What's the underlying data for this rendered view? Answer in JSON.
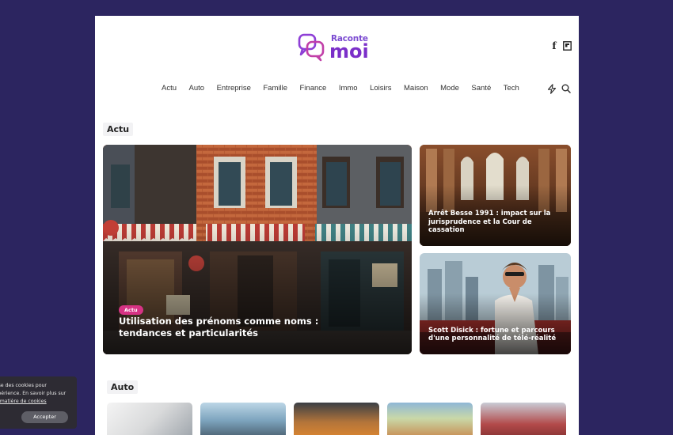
{
  "header": {
    "logo_top": "Raconte",
    "logo_bottom": "moi"
  },
  "social": {
    "icons": [
      "facebook-icon",
      "flipboard-icon"
    ]
  },
  "nav": {
    "items": [
      "Actu",
      "Auto",
      "Entreprise",
      "Famille",
      "Finance",
      "Immo",
      "Loisirs",
      "Maison",
      "Mode",
      "Santé",
      "Tech"
    ],
    "icons": [
      "bolt-icon",
      "search-icon"
    ]
  },
  "sections": {
    "actu": {
      "title": "Actu",
      "featured": {
        "tag": "Actu",
        "title": "Utilisation des prénoms comme noms : tendances et particularités"
      },
      "side": [
        {
          "title": "Arrêt Besse 1991 : impact sur la jurisprudence et la Cour de cassation"
        },
        {
          "title": "Scott Disick : fortune et parcours d'une personnalité de télé-réalité"
        }
      ]
    },
    "auto": {
      "title": "Auto"
    }
  },
  "cookie": {
    "line1": "tilise des cookies pour",
    "line2": "expérience. En savoir plus sur",
    "link": "en matière de cookies",
    "accept": "Accepter"
  },
  "colors": {
    "background": "#2c2560",
    "brand": "#7b2fc9",
    "tag": "#d63384"
  }
}
